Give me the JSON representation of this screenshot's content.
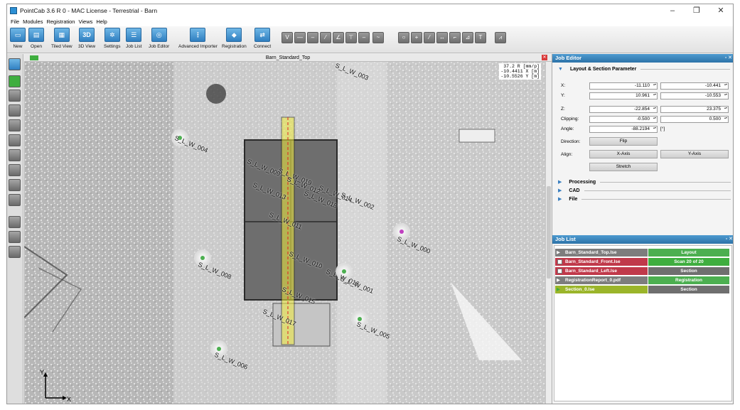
{
  "window": {
    "title": "PointCab 3.6 R 0 - MAC License - Terrestrial - Barn",
    "controls": [
      "–",
      "❐",
      "✕"
    ]
  },
  "menu": [
    "File",
    "Modules",
    "Registration",
    "Views",
    "Help"
  ],
  "toolbar": {
    "buttons": [
      {
        "label": "New"
      },
      {
        "label": "Open"
      },
      {
        "label": "Tiled View"
      },
      {
        "label": "3D View",
        "glyph": "3D"
      },
      {
        "label": "Settings"
      },
      {
        "label": "Job List"
      },
      {
        "label": "Job Editor"
      },
      {
        "label": "Advanced Importer"
      },
      {
        "label": "Registration"
      },
      {
        "label": "Connect"
      }
    ]
  },
  "view": {
    "tab_title": "Barn_Standard_Top",
    "readout": [
      "37.2 R [mm/p]",
      "-10.4411 X [m]",
      "-10.5526 Y [m]"
    ],
    "axis_x": "X",
    "axis_y": "Y",
    "scan_labels": [
      "S_L_W_003",
      "S_L_W_004",
      "S_L_W_009",
      "S_L_W_019",
      "S_L_W_012",
      "S_L_W_014",
      "S_L_W_002",
      "S_L_W_018",
      "S_L_W_013",
      "S_L_W_011",
      "S_L_W_000",
      "S_L_W_010",
      "S_L_W_008",
      "S_L_W_016",
      "S_L_W_001",
      "S_L_W_015",
      "S_L_W_017",
      "S_L_W_005",
      "S_L_W_006"
    ]
  },
  "job_editor": {
    "title": "Job Editor",
    "section_title": "Layout & Section Parameter",
    "x_label": "X:",
    "x_min": "-11.110",
    "x_max": "-10.441",
    "y_label": "Y:",
    "y_min": "10.961",
    "y_max": "-10.553",
    "z_label": "Z:",
    "z_min": "-22.854",
    "z_max": "23.375",
    "clipping_label": "Clipping:",
    "clip_min": "-0.500",
    "clip_max": "0.500",
    "angle_label": "Angle:",
    "angle": "-88.2194",
    "angle_unit": "[°]",
    "direction_label": "Direction:",
    "flip": "Flip",
    "align_label": "Align:",
    "x_axis": "X-Axis",
    "y_axis": "Y-Axis",
    "stretch": "Stretch",
    "collapsed": [
      "Processing",
      "CAD",
      "File"
    ]
  },
  "job_list": {
    "title": "Job List",
    "rows": [
      {
        "name": "Barn_Standard_Top.lse",
        "status": "Layout",
        "name_color": "#7d7d7d",
        "status_color": "#4caf50"
      },
      {
        "name": "Barn_Standard_Front.lse",
        "status": "Scan 20 of 20",
        "name_color": "#c0394a",
        "status_color": "#3fae3f"
      },
      {
        "name": "Barn_Standard_Left.lse",
        "status": "Section",
        "name_color": "#c0394a",
        "status_color": "#6f6f6f"
      },
      {
        "name": "RegistrationReport_0.pdf",
        "status": "Registration",
        "name_color": "#7d7d7d",
        "status_color": "#4caf50"
      },
      {
        "name": "Section_0.lse",
        "status": "Section",
        "name_color": "#9bb52a",
        "status_color": "#6f6f6f"
      }
    ]
  }
}
